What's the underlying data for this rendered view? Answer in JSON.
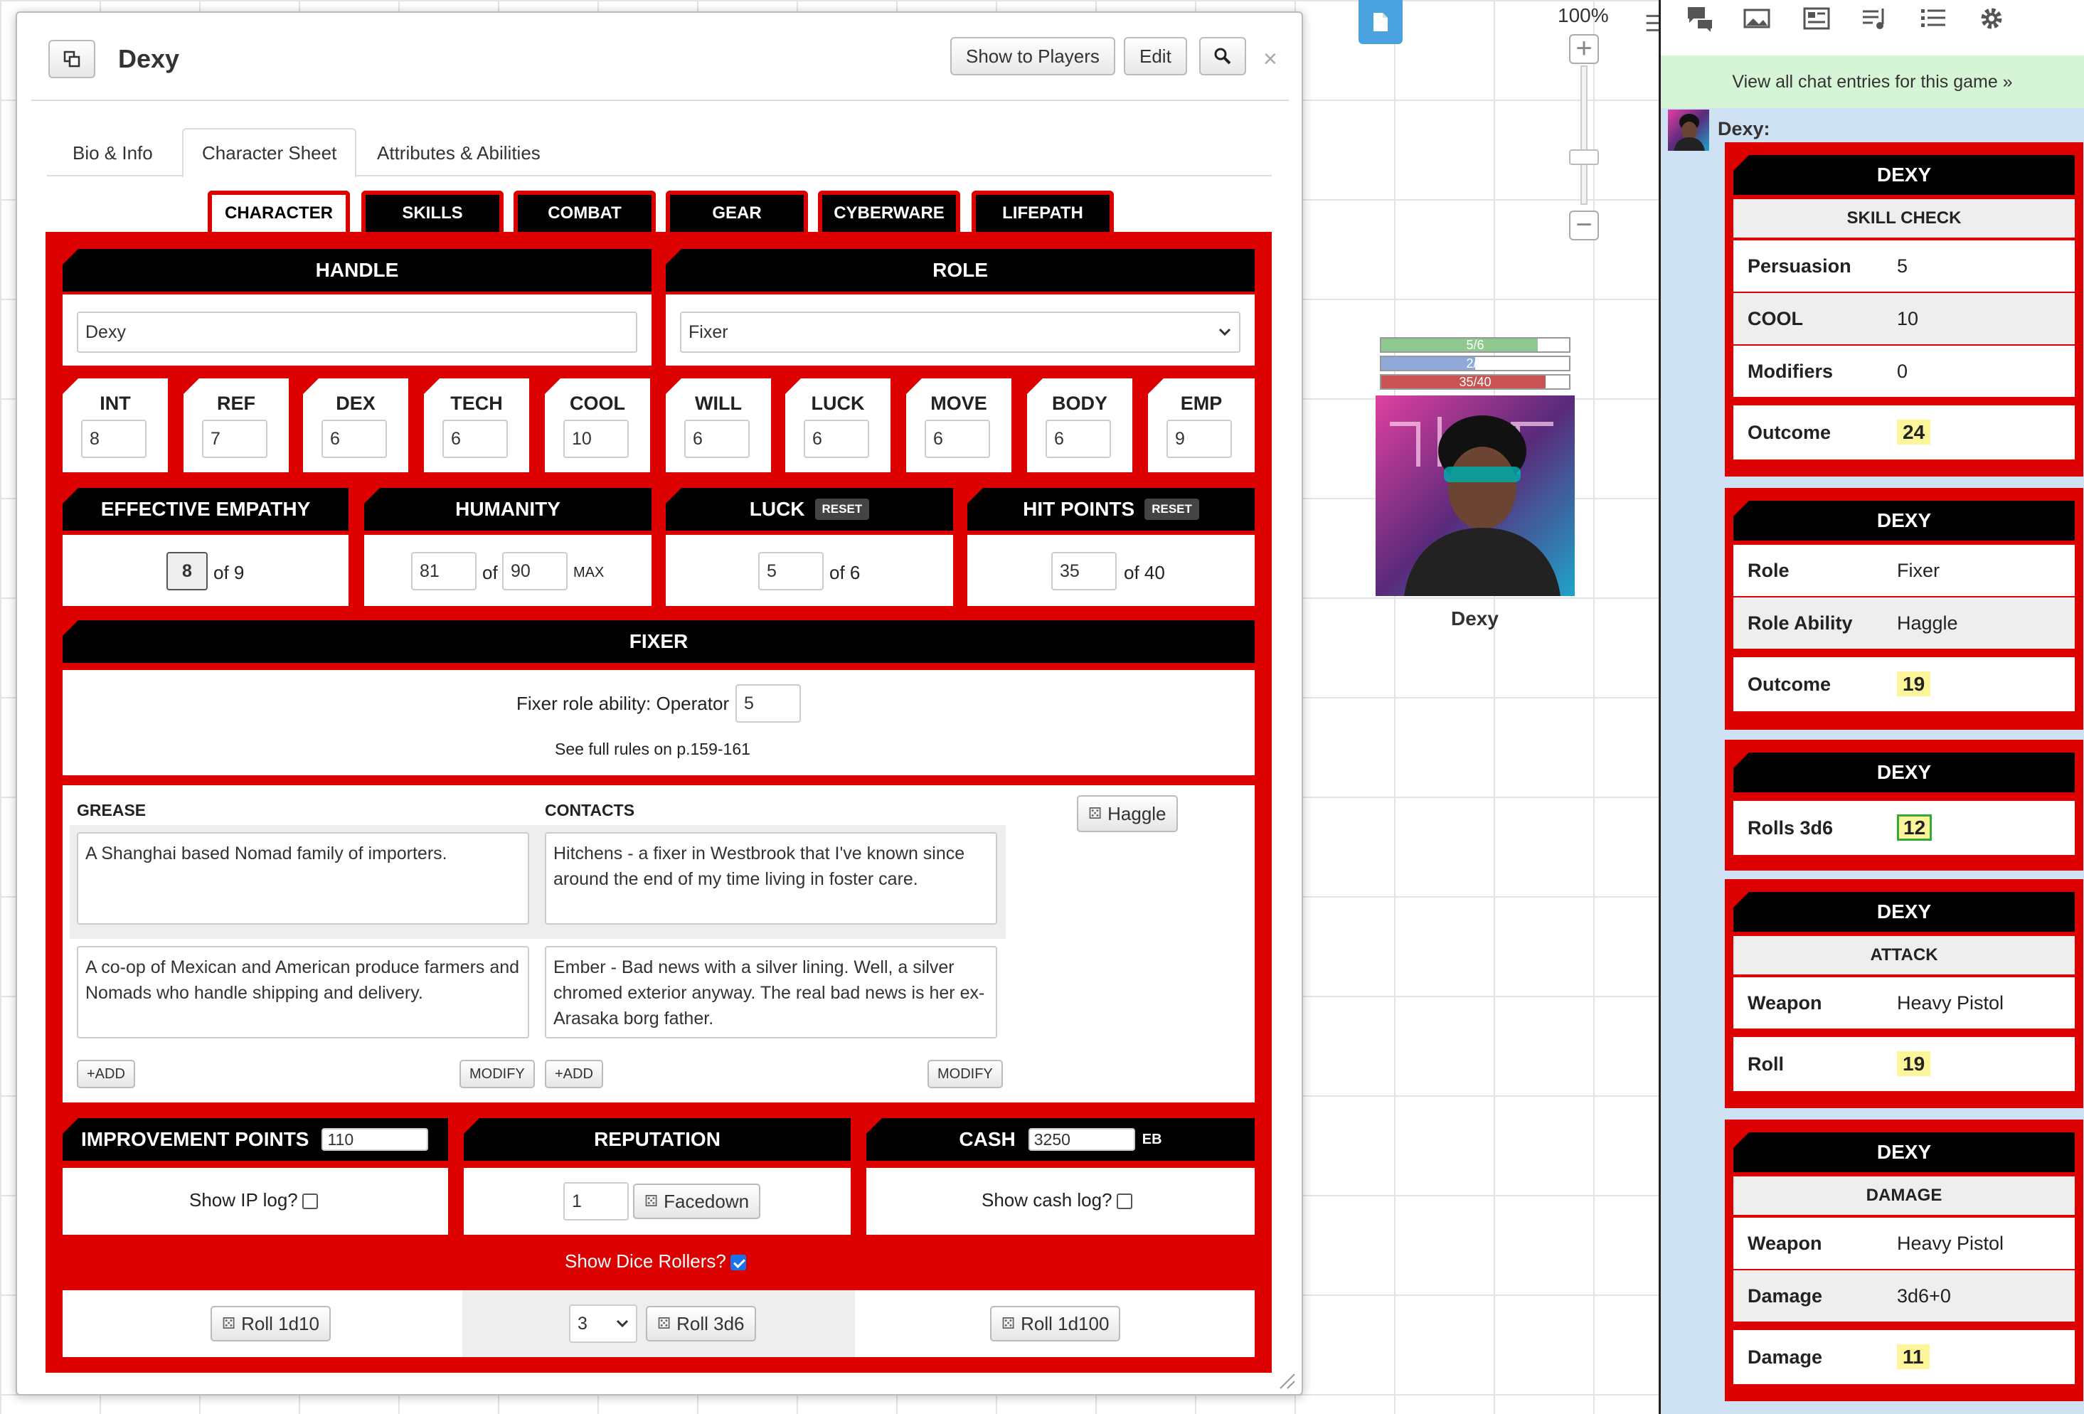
{
  "dialog": {
    "title": "Dexy",
    "buttons": {
      "show": "Show to Players",
      "edit": "Edit"
    },
    "tabs": [
      "Bio & Info",
      "Character Sheet",
      "Attributes & Abilities"
    ]
  },
  "sheet": {
    "subtabs": [
      "CHARACTER",
      "SKILLS",
      "COMBAT",
      "GEAR",
      "CYBERWARE",
      "LIFEPATH"
    ],
    "handle_label": "HANDLE",
    "handle_value": "Dexy",
    "role_label": "ROLE",
    "role_value": "Fixer",
    "stats": [
      {
        "label": "INT",
        "value": "8"
      },
      {
        "label": "REF",
        "value": "7"
      },
      {
        "label": "DEX",
        "value": "6"
      },
      {
        "label": "TECH",
        "value": "6"
      },
      {
        "label": "COOL",
        "value": "10"
      },
      {
        "label": "WILL",
        "value": "6"
      },
      {
        "label": "LUCK",
        "value": "6"
      },
      {
        "label": "MOVE",
        "value": "6"
      },
      {
        "label": "BODY",
        "value": "6"
      },
      {
        "label": "EMP",
        "value": "9"
      }
    ],
    "derived": {
      "empathy_label": "EFFECTIVE EMPATHY",
      "empathy_value": "8",
      "empathy_of": "of 9",
      "humanity_label": "HUMANITY",
      "humanity_value": "81",
      "humanity_of": "of",
      "humanity_max": "90",
      "max_label": "MAX",
      "luck_label": "LUCK",
      "luck_value": "5",
      "luck_of": "of 6",
      "hp_label": "HIT POINTS",
      "hp_value": "35",
      "hp_of": "of 40",
      "reset": "RESET"
    },
    "fixer": {
      "label": "FIXER",
      "ability_text": "Fixer role ability: Operator",
      "ability_value": "5",
      "rules": "See full rules on p.159-161"
    },
    "grease_label": "GREASE",
    "contacts_label": "CONTACTS",
    "haggle": "Haggle",
    "grease": [
      "A Shanghai based Nomad family of importers.",
      "A co-op of Mexican and American produce farmers and Nomads who handle shipping and delivery."
    ],
    "contacts": [
      "Hitchens - a fixer in Westbrook that I've known since around the end of my time living in foster care.",
      "Ember - Bad news with a silver lining. Well, a silver chromed exterior anyway. The real bad news is her ex-Arasaka borg father."
    ],
    "add": "+ADD",
    "modify": "MODIFY",
    "ip_label": "IMPROVEMENT POINTS",
    "ip_value": "110",
    "rep_label": "REPUTATION",
    "rep_value": "1",
    "facedown": "Facedown",
    "cash_label": "CASH",
    "cash_value": "3250",
    "eb": "EB",
    "show_ip": "Show IP log?",
    "show_cash": "Show cash log?",
    "show_dice": "Show Dice Rollers?",
    "roll_1d10": "Roll 1d10",
    "dice_count": "3",
    "roll_3d6": "Roll 3d6",
    "roll_1d100": "Roll 1d100"
  },
  "token": {
    "name": "Dexy",
    "bars": [
      {
        "text": "5/6",
        "value": 5,
        "max": 6,
        "color": "#8fc98f"
      },
      {
        "text": "2/4",
        "value": 2,
        "max": 4,
        "color": "#8fa9d9"
      },
      {
        "text": "35/40",
        "value": 35,
        "max": 40,
        "color": "#c95353"
      }
    ]
  },
  "zoom": "100%",
  "chat": {
    "view_all": "View all chat entries for this game »",
    "speaker": "Dexy:",
    "cards": [
      {
        "title": "DEXY",
        "sub": "SKILL CHECK",
        "rows": [
          [
            "Persuasion",
            "5"
          ],
          [
            "COOL",
            "10"
          ],
          [
            "Modifiers",
            "0"
          ]
        ],
        "out_label": "Outcome",
        "out": "24"
      },
      {
        "title": "DEXY",
        "rows": [
          [
            "Role",
            "Fixer"
          ],
          [
            "Role Ability",
            "Haggle"
          ]
        ],
        "out_label": "Outcome",
        "out": "19"
      },
      {
        "title": "DEXY",
        "out_label": "Rolls 3d6",
        "out": "12"
      },
      {
        "title": "DEXY",
        "sub": "ATTACK",
        "rows": [
          [
            "Weapon",
            "Heavy Pistol"
          ]
        ],
        "out_label": "Roll",
        "out": "19"
      },
      {
        "title": "DEXY",
        "sub": "DAMAGE",
        "rows": [
          [
            "Weapon",
            "Heavy Pistol"
          ],
          [
            "Damage",
            "3d6+0"
          ]
        ],
        "out_label": "Damage",
        "out": "11"
      }
    ]
  },
  "colors": {
    "accent": "#dd0000",
    "header": "#000000",
    "chat_bg": "#cfe2f3"
  }
}
